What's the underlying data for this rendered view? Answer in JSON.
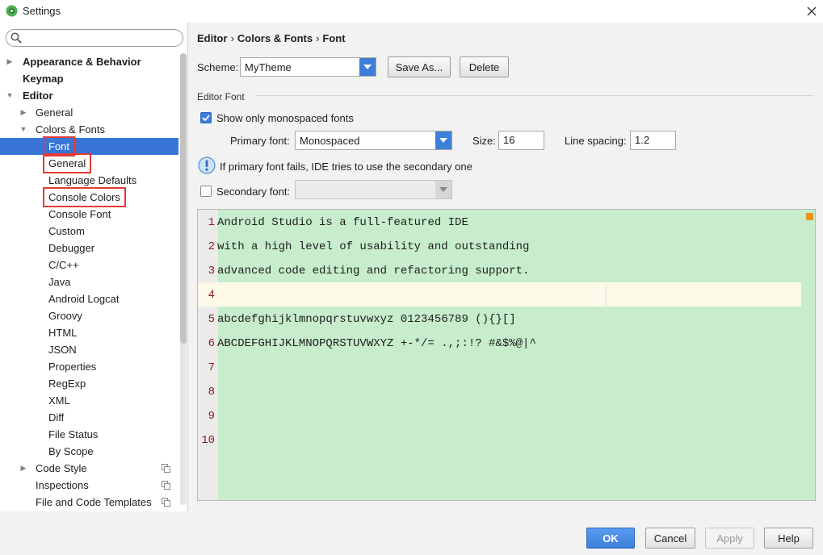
{
  "window": {
    "title": "Settings"
  },
  "search": {
    "placeholder": ""
  },
  "tree": [
    {
      "label": "Appearance & Behavior",
      "level": 0,
      "bold": true,
      "arrow": "right"
    },
    {
      "label": "Keymap",
      "level": 0,
      "bold": true,
      "arrow": ""
    },
    {
      "label": "Editor",
      "level": 0,
      "bold": true,
      "arrow": "down"
    },
    {
      "label": "General",
      "level": 1,
      "arrow": "right"
    },
    {
      "label": "Colors & Fonts",
      "level": 1,
      "arrow": "down"
    },
    {
      "label": "Font",
      "level": 2,
      "selected": true,
      "boxed": true
    },
    {
      "label": "General",
      "level": 2,
      "boxed": true
    },
    {
      "label": "Language Defaults",
      "level": 2
    },
    {
      "label": "Console Colors",
      "level": 2,
      "boxed": true
    },
    {
      "label": "Console Font",
      "level": 2
    },
    {
      "label": "Custom",
      "level": 2
    },
    {
      "label": "Debugger",
      "level": 2
    },
    {
      "label": "C/C++",
      "level": 2
    },
    {
      "label": "Java",
      "level": 2
    },
    {
      "label": "Android Logcat",
      "level": 2
    },
    {
      "label": "Groovy",
      "level": 2
    },
    {
      "label": "HTML",
      "level": 2
    },
    {
      "label": "JSON",
      "level": 2
    },
    {
      "label": "Properties",
      "level": 2
    },
    {
      "label": "RegExp",
      "level": 2
    },
    {
      "label": "XML",
      "level": 2
    },
    {
      "label": "Diff",
      "level": 2
    },
    {
      "label": "File Status",
      "level": 2
    },
    {
      "label": "By Scope",
      "level": 2
    },
    {
      "label": "Code Style",
      "level": 1,
      "arrow": "right",
      "copy": true
    },
    {
      "label": "Inspections",
      "level": 1,
      "copy": true
    },
    {
      "label": "File and Code Templates",
      "level": 1,
      "copy": true
    }
  ],
  "breadcrumb": {
    "part1": "Editor",
    "part2": "Colors & Fonts",
    "part3": "Font",
    "sep": "›"
  },
  "scheme": {
    "label": "Scheme:",
    "value": "MyTheme",
    "save_as": "Save As...",
    "delete": "Delete"
  },
  "editor_font": {
    "section_title": "Editor Font",
    "mono_only_label": "Show only monospaced fonts",
    "mono_only_checked": true,
    "primary_label": "Primary font:",
    "primary_value": "Monospaced",
    "size_label": "Size:",
    "size_value": "16",
    "spacing_label": "Line spacing:",
    "spacing_value": "1.2",
    "info_text": "If primary font fails, IDE tries to use the secondary one",
    "secondary_label": "Secondary font:",
    "secondary_checked": false,
    "secondary_value": ""
  },
  "preview": {
    "caret_line": 4,
    "lines": [
      {
        "num": "1",
        "text": "Android Studio is a full-featured IDE"
      },
      {
        "num": "2",
        "text": "with a high level of usability and outstanding"
      },
      {
        "num": "3",
        "text": "advanced code editing and refactoring support."
      },
      {
        "num": "4",
        "text": ""
      },
      {
        "num": "5",
        "text": "abcdefghijklmnopqrstuvwxyz 0123456789 (){}[]"
      },
      {
        "num": "6",
        "text": "ABCDEFGHIJKLMNOPQRSTUVWXYZ +-*/= .,;:!? #&$%@|^"
      },
      {
        "num": "7",
        "text": ""
      },
      {
        "num": "8",
        "text": ""
      },
      {
        "num": "9",
        "text": ""
      },
      {
        "num": "10",
        "text": ""
      }
    ]
  },
  "buttons": {
    "ok": "OK",
    "cancel": "Cancel",
    "apply": "Apply",
    "help": "Help"
  },
  "colors": {
    "accent": "#3875d7",
    "editor_bg": "#c7edcc",
    "caret_row": "#fcf9e8",
    "highlight_box": "#e53935",
    "line_number": "#8b1c1c"
  }
}
